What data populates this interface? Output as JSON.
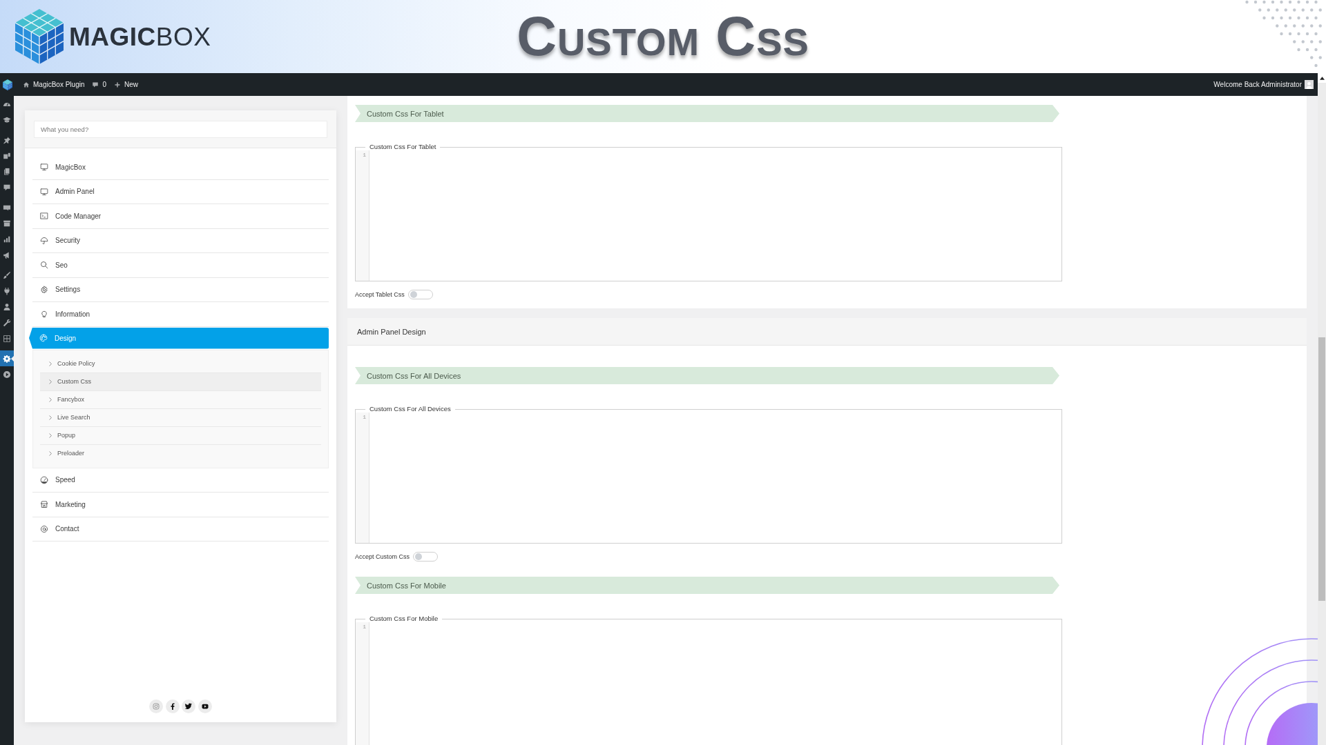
{
  "banner": {
    "logo_text": "**MAGIC**BOX",
    "title": "Custom Css"
  },
  "admin_bar": {
    "site_name": "MagicBox Plugin",
    "comment_count": "0",
    "new_label": "New",
    "greeting": "Welcome Back Administrator"
  },
  "admin_menu": {
    "groups": [
      {
        "items": [
          {
            "selected": false
          },
          {
            "selected": false
          }
        ]
      },
      {
        "items": [
          {
            "selected": false
          },
          {
            "selected": false
          },
          {
            "selected": false
          },
          {
            "selected": false
          }
        ]
      },
      {
        "items": [
          {
            "selected": false
          },
          {
            "selected": false
          },
          {
            "selected": false
          },
          {
            "selected": false
          }
        ]
      },
      {
        "items": [
          {
            "selected": false
          },
          {
            "selected": false
          },
          {
            "selected": false
          },
          {
            "selected": false
          },
          {
            "selected": false
          }
        ]
      },
      {
        "items": [
          {
            "selected": true
          },
          {
            "selected": false
          }
        ]
      }
    ]
  },
  "plugin_menu": {
    "search": {
      "placeholder": "What you need?"
    },
    "items": [
      {
        "label": "MagicBox",
        "selected": false
      },
      {
        "label": "Admin Panel",
        "selected": false
      },
      {
        "label": "Code Manager",
        "selected": false
      },
      {
        "label": "Security",
        "selected": false
      },
      {
        "label": "Seo",
        "selected": false
      },
      {
        "label": "Settings",
        "selected": false
      },
      {
        "label": "Information",
        "selected": false
      },
      {
        "label": "Design",
        "selected": true,
        "children": [
          {
            "label": "Cookie Policy",
            "selected": false
          },
          {
            "label": "Custom Css",
            "selected": true
          },
          {
            "label": "Fancybox",
            "selected": false
          },
          {
            "label": "Live Search",
            "selected": false
          },
          {
            "label": "Popup",
            "selected": false
          },
          {
            "label": "Preloader",
            "selected": false
          }
        ]
      },
      {
        "label": "Speed",
        "selected": false
      },
      {
        "label": "Marketing",
        "selected": false
      },
      {
        "label": "Contact",
        "selected": false
      }
    ]
  },
  "panels": [
    {
      "sections": [
        {
          "heading": "Custom Css For Tablet",
          "editor": {
            "label": "Custom Css For Tablet",
            "line_number": "1"
          },
          "toggle": {
            "label": "Accept Tablet Css",
            "on": false
          }
        }
      ]
    },
    {
      "title": "Admin Panel Design",
      "sections": [
        {
          "heading": "Custom Css For All Devices",
          "editor": {
            "label": "Custom Css For All Devices",
            "line_number": "1"
          },
          "toggle": {
            "label": "Accept Custom Css",
            "on": false
          }
        },
        {
          "heading": "Custom Css For Mobile",
          "editor": {
            "label": "Custom Css For Mobile",
            "line_number": "1"
          }
        }
      ]
    }
  ]
}
